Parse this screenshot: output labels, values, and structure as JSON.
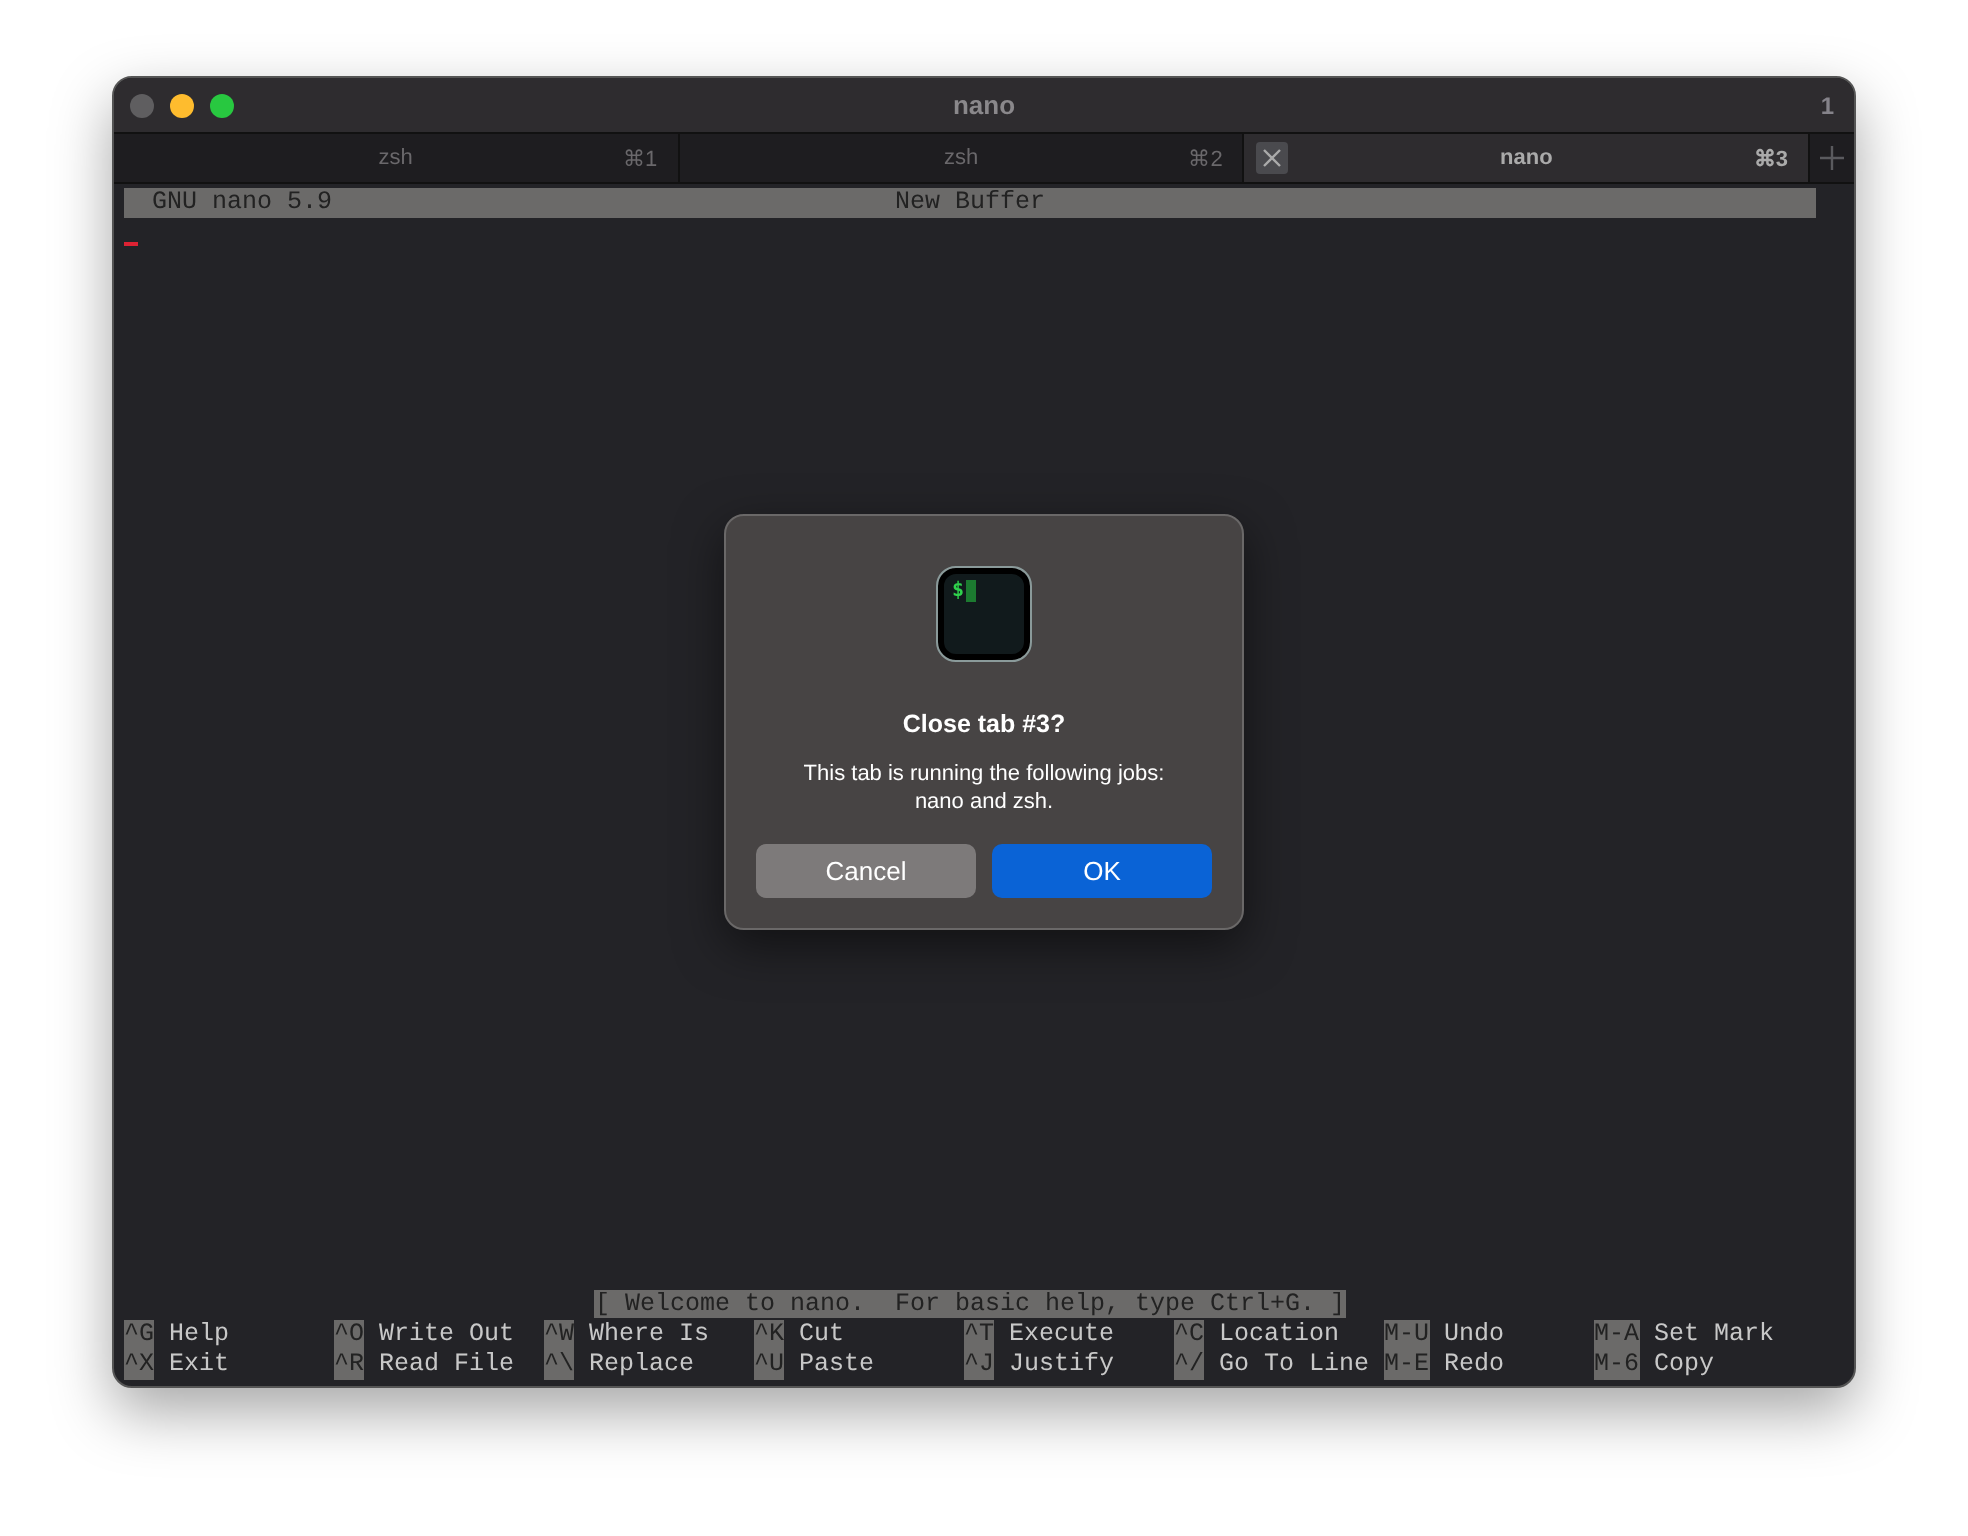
{
  "window": {
    "title": "nano",
    "tab_count": "1"
  },
  "tabs": [
    {
      "label": "zsh",
      "shortcut": "⌘1",
      "selected": false
    },
    {
      "label": "zsh",
      "shortcut": "⌘2",
      "selected": false
    },
    {
      "label": "nano",
      "shortcut": "⌘3",
      "selected": true
    }
  ],
  "nano": {
    "version": "GNU nano 5.9",
    "buffer": "New Buffer",
    "status": "[ Welcome to nano.  For basic help, type Ctrl+G. ]",
    "shortcut_rows": [
      [
        {
          "key": "^G",
          "label": "Help"
        },
        {
          "key": "^O",
          "label": "Write Out"
        },
        {
          "key": "^W",
          "label": "Where Is"
        },
        {
          "key": "^K",
          "label": "Cut"
        },
        {
          "key": "^T",
          "label": "Execute"
        },
        {
          "key": "^C",
          "label": "Location"
        },
        {
          "key": "M-U",
          "label": "Undo"
        },
        {
          "key": "M-A",
          "label": "Set Mark"
        }
      ],
      [
        {
          "key": "^X",
          "label": "Exit"
        },
        {
          "key": "^R",
          "label": "Read File"
        },
        {
          "key": "^\\",
          "label": "Replace"
        },
        {
          "key": "^U",
          "label": "Paste"
        },
        {
          "key": "^J",
          "label": "Justify"
        },
        {
          "key": "^/",
          "label": "Go To Line"
        },
        {
          "key": "M-E",
          "label": "Redo"
        },
        {
          "key": "M-6",
          "label": "Copy"
        }
      ]
    ]
  },
  "dialog": {
    "title": "Close tab #3?",
    "message": "This tab is running the following jobs: nano and zsh.",
    "icon_prompt": "$",
    "buttons": [
      {
        "label": "Cancel",
        "kind": "secondary"
      },
      {
        "label": "OK",
        "kind": "primary"
      }
    ]
  }
}
